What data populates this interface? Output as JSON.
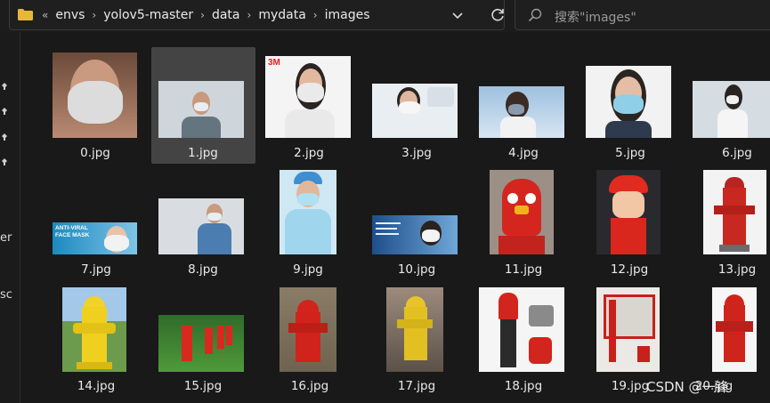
{
  "breadcrumb": [
    "envs",
    "yolov5-master",
    "data",
    "mydata",
    "images"
  ],
  "search": {
    "placeholder": "搜索\"images\""
  },
  "nav_fragments": [
    "er",
    "sc"
  ],
  "files": [
    {
      "name": "0.jpg",
      "kind": "mask"
    },
    {
      "name": "1.jpg",
      "kind": "mask"
    },
    {
      "name": "2.jpg",
      "kind": "mask"
    },
    {
      "name": "3.jpg",
      "kind": "mask"
    },
    {
      "name": "4.jpg",
      "kind": "mask"
    },
    {
      "name": "5.jpg",
      "kind": "mask"
    },
    {
      "name": "6.jpg",
      "kind": "mask"
    },
    {
      "name": "7.jpg",
      "kind": "mask"
    },
    {
      "name": "8.jpg",
      "kind": "mask"
    },
    {
      "name": "9.jpg",
      "kind": "mask"
    },
    {
      "name": "10.jpg",
      "kind": "mask"
    },
    {
      "name": "11.jpg",
      "kind": "hydrant"
    },
    {
      "name": "12.jpg",
      "kind": "hydrant"
    },
    {
      "name": "13.jpg",
      "kind": "hydrant"
    },
    {
      "name": "14.jpg",
      "kind": "hydrant"
    },
    {
      "name": "15.jpg",
      "kind": "hydrant"
    },
    {
      "name": "16.jpg",
      "kind": "hydrant"
    },
    {
      "name": "17.jpg",
      "kind": "hydrant"
    },
    {
      "name": "18.jpg",
      "kind": "hydrant"
    },
    {
      "name": "19.jpg",
      "kind": "hydrant"
    },
    {
      "name": "20.jpg",
      "kind": "hydrant"
    }
  ],
  "selected_file": "1.jpg",
  "thumb_text": {
    "brand_3m": "3M",
    "antiviral": "ANTI-VIRAL FACE MASK"
  },
  "watermark": "CSDN @一锋",
  "colors": {
    "background": "#191919",
    "selection": "#444444",
    "folder": "#e8b73a"
  }
}
